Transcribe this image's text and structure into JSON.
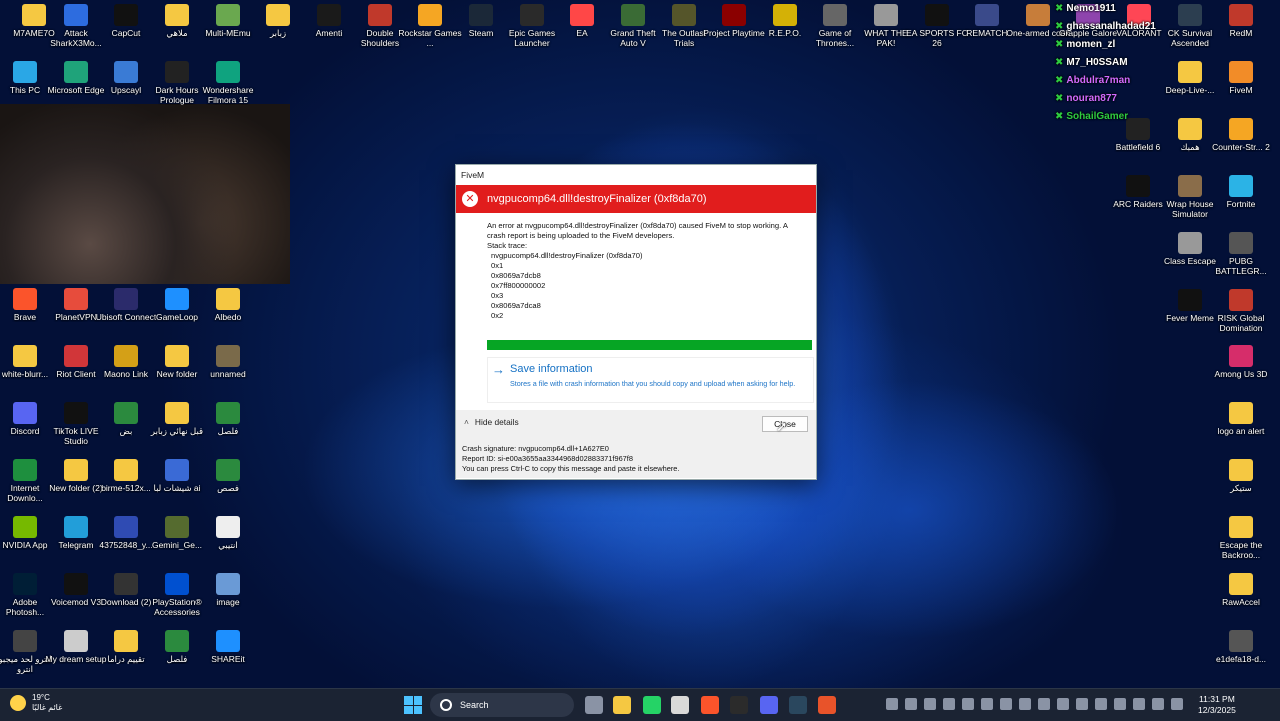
{
  "desktop": {
    "icons": [
      {
        "label": "M7AME7O",
        "color": "#f5c842"
      },
      {
        "label": "Attack SharkX3Mo...",
        "color": "#2d6cdf"
      },
      {
        "label": "CapCut",
        "color": "#111111"
      },
      {
        "label": "ملاهي",
        "color": "#f5c842"
      },
      {
        "label": "Multi-MEmu",
        "color": "#6aa84f"
      },
      {
        "label": "زبابر",
        "color": "#f5c842"
      },
      {
        "label": "Amenti",
        "color": "#1a1a1a"
      },
      {
        "label": "Double Shoulders",
        "color": "#c0392b"
      },
      {
        "label": "Rockstar Games ...",
        "color": "#f5a623"
      },
      {
        "label": "Steam",
        "color": "#1b2838"
      },
      {
        "label": "Epic Games Launcher",
        "color": "#2a2a2a"
      },
      {
        "label": "EA",
        "color": "#ff4747"
      },
      {
        "label": "Grand Theft Auto V",
        "color": "#3a6b35"
      },
      {
        "label": "The Outlast Trials",
        "color": "#55552a"
      },
      {
        "label": "Project Playtime",
        "color": "#8b0000"
      },
      {
        "label": "R.E.P.O.",
        "color": "#d4b106"
      },
      {
        "label": "Game of Thrones...",
        "color": "#666666"
      },
      {
        "label": "WHAT THE PAK!",
        "color": "#999999"
      },
      {
        "label": "EA SPORTS FC 26",
        "color": "#111111"
      },
      {
        "label": "REMATCH",
        "color": "#3a4a8a"
      },
      {
        "label": "One-armed cook",
        "color": "#c77d3a"
      },
      {
        "label": "Grapple Galore",
        "color": "#8e44ad"
      },
      {
        "label": "VALORANT",
        "color": "#ff4655"
      },
      {
        "label": "CK Survival Ascended",
        "color": "#2c3e50"
      },
      {
        "label": "RedM",
        "color": "#c0392b"
      },
      {
        "label": "This PC",
        "color": "#2aa7e6"
      },
      {
        "label": "Microsoft Edge",
        "color": "#1fa37a"
      },
      {
        "label": "Upscayl",
        "color": "#3a7bd5"
      },
      {
        "label": "Dark Hours Prologue",
        "color": "#222222"
      },
      {
        "label": "Wondershare Filmora 15",
        "color": "#0fa37f"
      },
      {
        "label": "Brave",
        "color": "#fb542b"
      },
      {
        "label": "PlanetVPN",
        "color": "#e74c3c"
      },
      {
        "label": "Ubisoft Connect",
        "color": "#2b2b6b"
      },
      {
        "label": "GameLoop",
        "color": "#1e90ff"
      },
      {
        "label": "Albedo",
        "color": "#f5c842"
      },
      {
        "label": "white-blurr...",
        "color": "#f5c842"
      },
      {
        "label": "Riot Client",
        "color": "#d13639"
      },
      {
        "label": "Maono Link",
        "color": "#d4a017"
      },
      {
        "label": "New folder",
        "color": "#f5c842"
      },
      {
        "label": "unnamed",
        "color": "#7a6a4a"
      },
      {
        "label": "Discord",
        "color": "#5865f2"
      },
      {
        "label": "TikTok LIVE Studio",
        "color": "#111111"
      },
      {
        "label": "بض",
        "color": "#2b8a3e"
      },
      {
        "label": "قبل نهائي زبابر",
        "color": "#f5c842"
      },
      {
        "label": "فلصل",
        "color": "#2b8a3e"
      },
      {
        "label": "Internet Downlo...",
        "color": "#1e8f3e"
      },
      {
        "label": "New folder (2)",
        "color": "#f5c842"
      },
      {
        "label": "birme-512x...",
        "color": "#f5c842"
      },
      {
        "label": "شيشات لبا ai",
        "color": "#3a6ad6"
      },
      {
        "label": "فصص",
        "color": "#2b8a3e"
      },
      {
        "label": "NVIDIA App",
        "color": "#76b900"
      },
      {
        "label": "Telegram",
        "color": "#229ed9"
      },
      {
        "label": "43752848_y...",
        "color": "#2f4bb3"
      },
      {
        "label": "Gemini_Ge...",
        "color": "#556b2f"
      },
      {
        "label": "انتيبي",
        "color": "#eeeeee"
      },
      {
        "label": "Adobe Photosh...",
        "color": "#001e36"
      },
      {
        "label": "Voicemod V3",
        "color": "#111111"
      },
      {
        "label": "Download (2)",
        "color": "#333333"
      },
      {
        "label": "PlayStation® Accessories",
        "color": "#0050d0"
      },
      {
        "label": "image",
        "color": "#6a9ad6"
      },
      {
        "label": "انترو لحد ميجبو انترو",
        "color": "#444444"
      },
      {
        "label": "My dream setup",
        "color": "#cccccc"
      },
      {
        "label": "تقييم دراما",
        "color": "#f5c842"
      },
      {
        "label": "فلصل",
        "color": "#2b8a3e"
      },
      {
        "label": "SHAREit",
        "color": "#1e90ff"
      },
      {
        "label": "Battlefield 6",
        "color": "#222222"
      },
      {
        "label": "همبك",
        "color": "#f5c842"
      },
      {
        "label": "Counter-Str... 2",
        "color": "#f5a623"
      },
      {
        "label": "Deep-Live-...",
        "color": "#f5c842"
      },
      {
        "label": "FiveM",
        "color": "#f28c28"
      },
      {
        "label": "ARC Raiders",
        "color": "#111111"
      },
      {
        "label": "Wrap House Simulator",
        "color": "#8a6d4a"
      },
      {
        "label": "Fortnite",
        "color": "#2bb3e6"
      },
      {
        "label": "Class Escape",
        "color": "#999999"
      },
      {
        "label": "PUBG BATTLEGR...",
        "color": "#555555"
      },
      {
        "label": "Fever Meme",
        "color": "#111111"
      },
      {
        "label": "RISK Global Domination",
        "color": "#c0392b"
      },
      {
        "label": "Among Us 3D",
        "color": "#d62d6a"
      },
      {
        "label": "logo an alert",
        "color": "#f5c842"
      },
      {
        "label": "ستيكر",
        "color": "#f5c842"
      },
      {
        "label": "Escape the Backroo...",
        "color": "#f5c842"
      },
      {
        "label": "RawAccel",
        "color": "#f5c842"
      },
      {
        "label": "e1defa18-d...",
        "color": "#555555"
      }
    ]
  },
  "chat": {
    "messages": [
      {
        "user": "Nemo1911",
        "color": "#ffffff"
      },
      {
        "user": "ghassanalhadad21",
        "color": "#ffffff"
      },
      {
        "user": "momen_zl",
        "color": "#ffffff"
      },
      {
        "user": "M7_H0SSAM",
        "color": "#ffffff"
      },
      {
        "user": "Abdulra7man",
        "color": "#d36bff"
      },
      {
        "user": "nouran877",
        "color": "#d36bff"
      },
      {
        "user": "SohailGamer",
        "color": "#2ecc40"
      }
    ]
  },
  "dialog": {
    "window_title": "FiveM",
    "error_title": "nvgpucomp64.dll!destroyFinalizer (0xf8da70)",
    "message": "An error at nvgpucomp64.dll!destroyFinalizer (0xf8da70) caused FiveM to stop working. A crash report is being uploaded to the FiveM developers.",
    "stack_label": "Stack trace:",
    "stack_trace": [
      "nvgpucomp64.dll!destroyFinalizer (0xf8da70)",
      "0x1",
      "0x8069a7dcb8",
      "0x7ff800000002",
      "0x3",
      "0x8069a7dca8",
      "0x2"
    ],
    "upload_progress": 1.0,
    "progress_color": "#06a524",
    "save_title": "Save information",
    "save_desc": "Stores a file with crash information that you should copy and upload when asking for help.",
    "hide_details": "Hide details",
    "close_label": "Close",
    "crash_signature": "Crash signature: nvgpucomp64.dll+1A627E0",
    "report_id": "Report ID: si-e00a3655aa3344968d02883371f967f8",
    "copy_hint": "You can press Ctrl-C to copy this message and paste it elsewhere.",
    "accent_color": "#e11d1d"
  },
  "taskbar": {
    "weather_temp": "19°C",
    "weather_desc": "غائم غالبًا",
    "search_label": "Search",
    "time": "11:31 PM",
    "date": "12/3/2025",
    "pinned": [
      {
        "name": "task-view-icon",
        "color": "#8a93a5"
      },
      {
        "name": "file-explorer-icon",
        "color": "#f5c842"
      },
      {
        "name": "whatsapp-icon",
        "color": "#25d366"
      },
      {
        "name": "snipping-tool-icon",
        "color": "#d9d9d9"
      },
      {
        "name": "brave-icon",
        "color": "#fb542b"
      },
      {
        "name": "terminal-icon",
        "color": "#2b2b2b"
      },
      {
        "name": "discord-icon",
        "color": "#5865f2"
      },
      {
        "name": "steam-icon",
        "color": "#2a475e"
      },
      {
        "name": "fivem-icon",
        "color": "#e8532a"
      }
    ]
  }
}
